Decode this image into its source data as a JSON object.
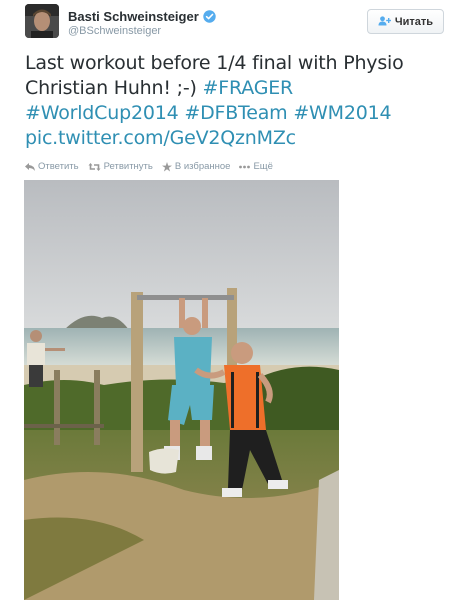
{
  "user": {
    "name": "Basti Schweinsteiger",
    "handle": "@BSchweinsteiger",
    "verified": true
  },
  "follow_button": {
    "label": "Читать",
    "icon": "add-user-icon"
  },
  "tweet": {
    "text_plain": "Last workout before 1/4 final with Physio Christian Huhn! ;-)",
    "hashtags": [
      "#FRAGER",
      "#WorldCup2014",
      "#DFBTeam",
      "#WM2014"
    ],
    "link": "pic.twitter.com/GeV2QznMZc"
  },
  "actions": [
    {
      "label": "Ответить",
      "icon": "reply-icon"
    },
    {
      "label": "Ретвитнуть",
      "icon": "retweet-icon"
    },
    {
      "label": "В избранное",
      "icon": "star-icon"
    },
    {
      "label": "Ещё",
      "icon": "more-icon"
    }
  ],
  "colors": {
    "link": "#2f8fb3",
    "verified": "#55acee",
    "muted": "#8899a6",
    "text": "#292f33"
  }
}
